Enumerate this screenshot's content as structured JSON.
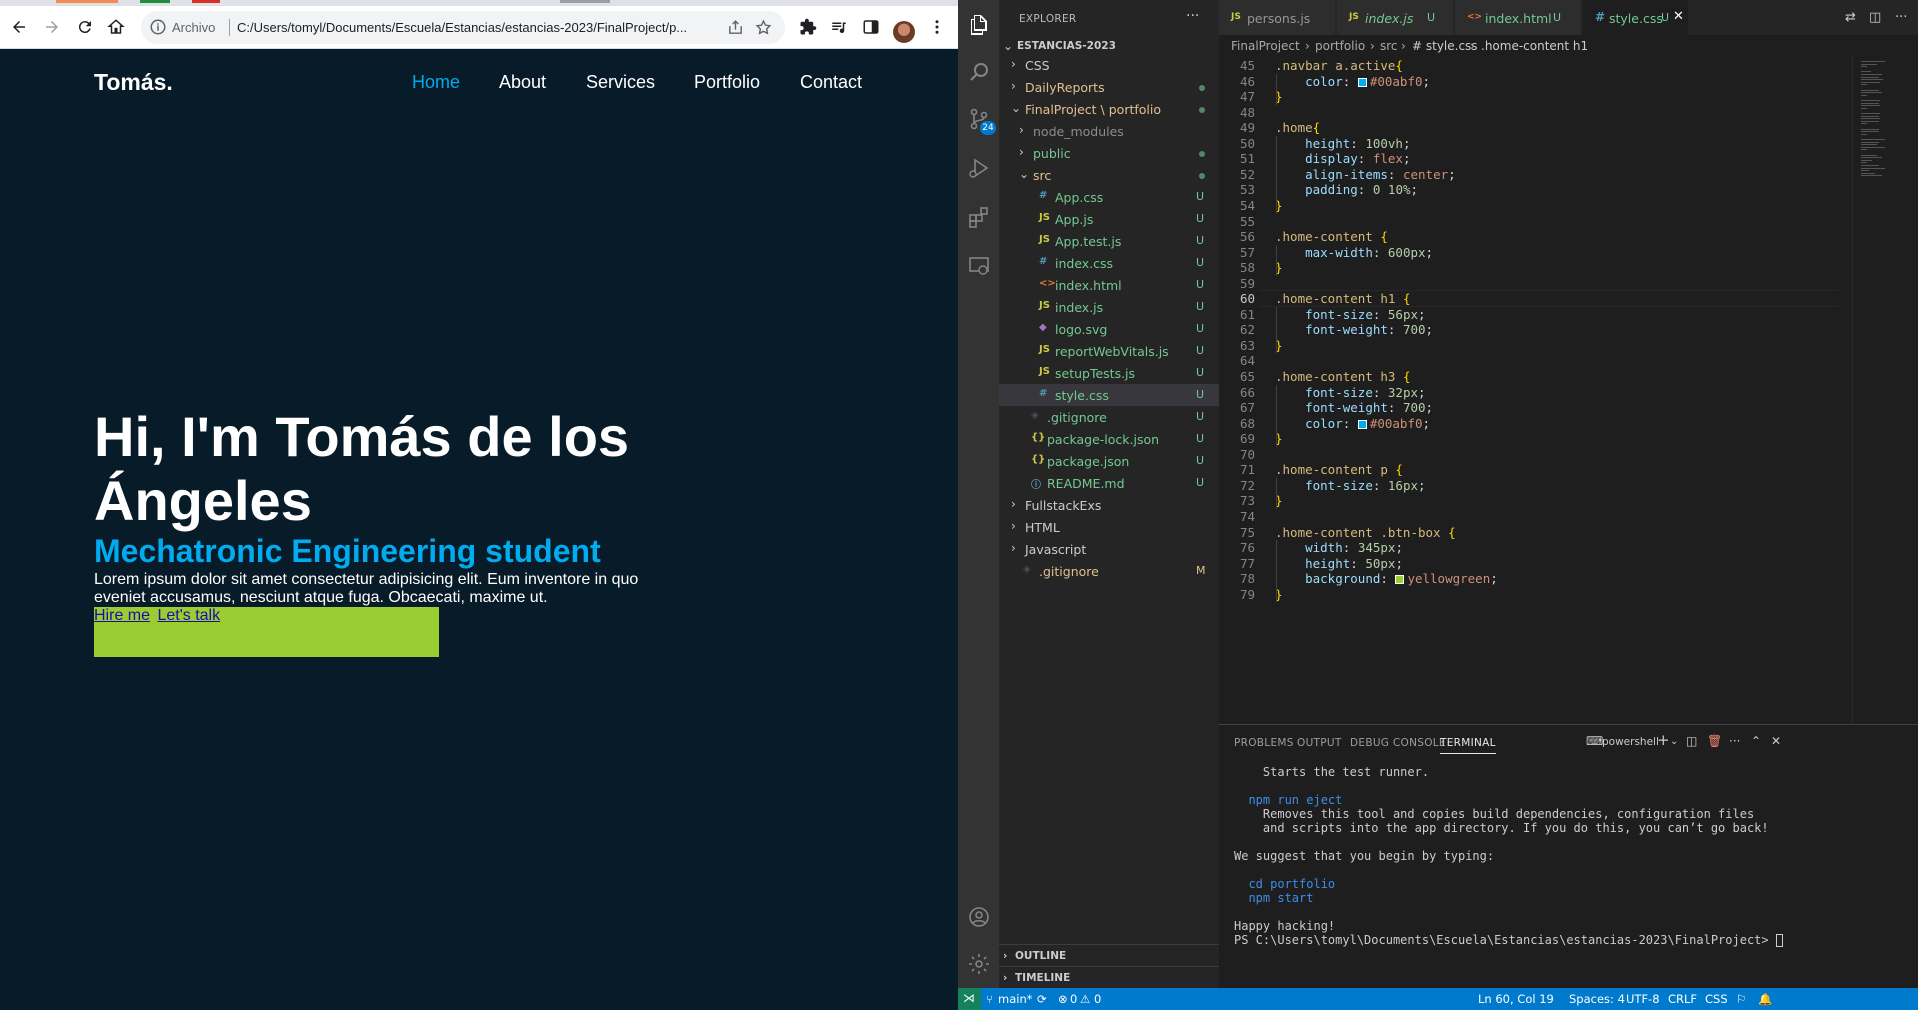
{
  "browser": {
    "omnibox": {
      "security_label": "Archivo",
      "url": "C:/Users/tomyl/Documents/Escuela/Estancias/estancias-2023/FinalProject/p..."
    },
    "site": {
      "logo": "Tomás.",
      "nav": [
        "Home",
        "About",
        "Services",
        "Portfolio",
        "Contact"
      ],
      "active_nav": "Home",
      "heading": "Hi, I'm Tomás de los Ángeles",
      "subheading": "Mechatronic Engineering student",
      "paragraph": "Lorem ipsum dolor sit amet consectetur adipisicing elit. Eum inventore in quo eveniet accusamus, nesciunt atque fuga. Obcaecati, maxime ut.",
      "links": [
        "Hire me",
        "Let's talk"
      ],
      "colors": {
        "background": "#081b29",
        "accent": "#00abf0",
        "button_box": "yellowgreen"
      }
    }
  },
  "vscode": {
    "activity_badge": "24",
    "explorer": {
      "header": "EXPLORER",
      "root": "ESTANCIAS-2023",
      "items": [
        {
          "label": "CSS",
          "kind": "folder",
          "status": ""
        },
        {
          "label": "DailyReports",
          "kind": "folder",
          "status": "dot"
        },
        {
          "label": "FinalProject \\ portfolio",
          "kind": "folder-open",
          "status": "dot"
        },
        {
          "label": "node_modules",
          "kind": "folder",
          "status": ""
        },
        {
          "label": "public",
          "kind": "folder",
          "status": "dot"
        },
        {
          "label": "src",
          "kind": "folder-open",
          "status": "dot"
        },
        {
          "label": "App.css",
          "kind": "css",
          "status": "U"
        },
        {
          "label": "App.js",
          "kind": "js",
          "status": "U"
        },
        {
          "label": "App.test.js",
          "kind": "js",
          "status": "U"
        },
        {
          "label": "index.css",
          "kind": "css",
          "status": "U"
        },
        {
          "label": "index.html",
          "kind": "html",
          "status": "U"
        },
        {
          "label": "index.js",
          "kind": "js",
          "status": "U"
        },
        {
          "label": "logo.svg",
          "kind": "svg",
          "status": "U"
        },
        {
          "label": "reportWebVitals.js",
          "kind": "js",
          "status": "U"
        },
        {
          "label": "setupTests.js",
          "kind": "js",
          "status": "U"
        },
        {
          "label": "style.css",
          "kind": "css",
          "status": "U"
        },
        {
          "label": ".gitignore",
          "kind": "git",
          "status": "U"
        },
        {
          "label": "package-lock.json",
          "kind": "json",
          "status": "U"
        },
        {
          "label": "package.json",
          "kind": "json",
          "status": "U"
        },
        {
          "label": "README.md",
          "kind": "info",
          "status": "U"
        },
        {
          "label": "FullstackExs",
          "kind": "folder",
          "status": ""
        },
        {
          "label": "HTML",
          "kind": "folder",
          "status": ""
        },
        {
          "label": "Javascript",
          "kind": "folder",
          "status": ""
        },
        {
          "label": ".gitignore",
          "kind": "git",
          "status": "M"
        }
      ],
      "outline": "OUTLINE",
      "timeline": "TIMELINE"
    },
    "tabs": [
      {
        "label": "persons.js",
        "icon": "JS",
        "status": ""
      },
      {
        "label": "index.js",
        "icon": "JS",
        "status": "U"
      },
      {
        "label": "index.html",
        "icon": "<>",
        "status": "U"
      },
      {
        "label": "style.css",
        "icon": "#",
        "status": "U",
        "active": true
      }
    ],
    "breadcrumb": [
      "FinalProject",
      "portfolio",
      "src",
      "# style.css",
      ".home-content h1"
    ],
    "code": {
      "line_numbers": [
        "45",
        "46",
        "47",
        "48",
        "49",
        "50",
        "51",
        "52",
        "53",
        "54",
        "55",
        "56",
        "57",
        "58",
        "59",
        "60",
        "61",
        "62",
        "63",
        "64",
        "65",
        "66",
        "67",
        "68",
        "69",
        "70",
        "71",
        "72",
        "73",
        "74",
        "75",
        "76",
        "77",
        "78",
        "79"
      ],
      "current_line": "60",
      "lines": [
        ".navbar a.active{",
        "    color: #00abf0;",
        "}",
        "",
        ".home{",
        "    height: 100vh;",
        "    display: flex;",
        "    align-items: center;",
        "    padding: 0 10%;",
        "}",
        "",
        ".home-content {",
        "    max-width: 600px;",
        "}",
        "",
        ".home-content h1 {",
        "    font-size: 56px;",
        "    font-weight: 700;",
        "}",
        "",
        ".home-content h3 {",
        "    font-size: 32px;",
        "    font-weight: 700;",
        "    color: #00abf0;",
        "}",
        "",
        ".home-content p {",
        "    font-size: 16px;",
        "}",
        "",
        ".home-content .btn-box {",
        "    width: 345px;",
        "    height: 50px;",
        "    background: yellowgreen;",
        "}"
      ]
    },
    "panel": {
      "tabs": [
        "PROBLEMS",
        "OUTPUT",
        "DEBUG CONSOLE",
        "TERMINAL"
      ],
      "active_tab": "TERMINAL",
      "shell": "powershell",
      "terminal_lines": [
        "    Starts the test runner.",
        "",
        "  npm run eject",
        "    Removes this tool and copies build dependencies, configuration files",
        "    and scripts into the app directory. If you do this, you can’t go back!",
        "",
        "We suggest that you begin by typing:",
        "",
        "  cd portfolio",
        "  npm start",
        "",
        "Happy hacking!",
        "PS C:\\Users\\tomyl\\Documents\\Escuela\\Estancias\\estancias-2023\\FinalProject> "
      ]
    },
    "status": {
      "branch": "main*",
      "errors": "0",
      "warnings": "0",
      "position": "Ln 60, Col 19",
      "spaces": "Spaces: 4",
      "encoding": "UTF-8",
      "eol": "CRLF",
      "language": "CSS"
    }
  }
}
